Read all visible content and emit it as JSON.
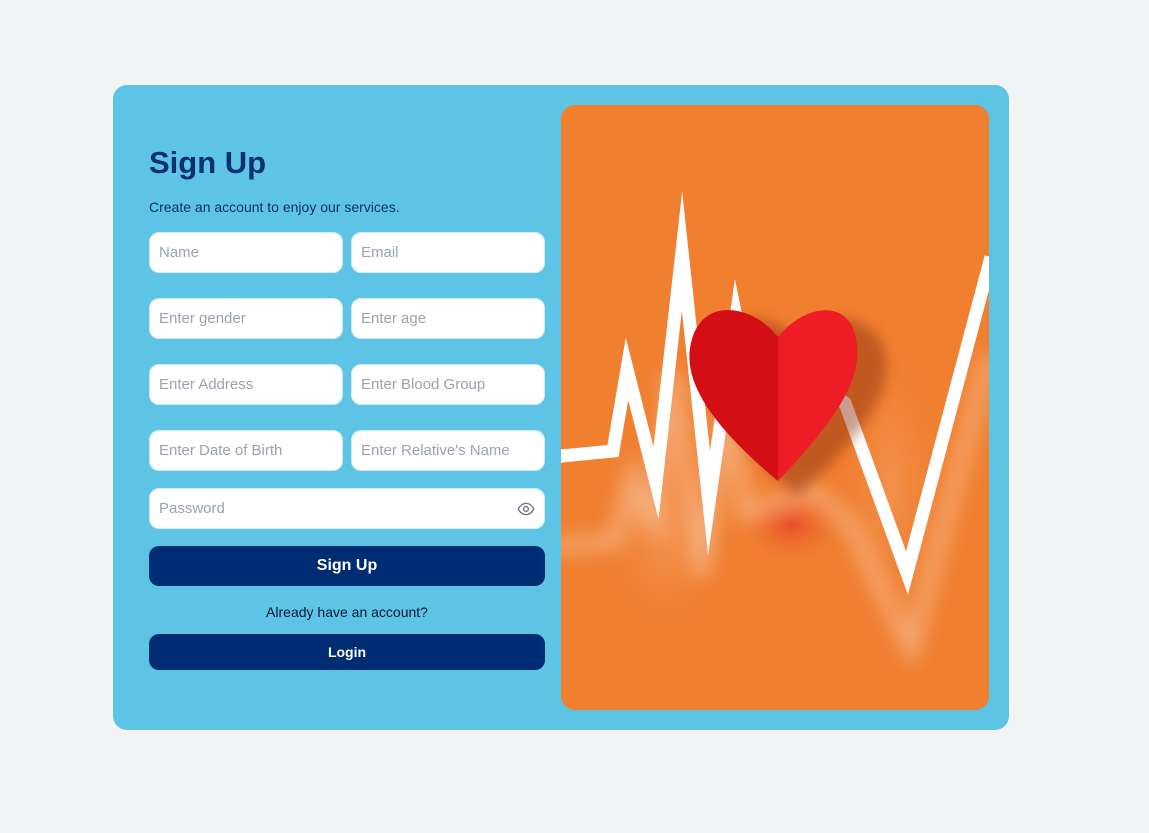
{
  "signup": {
    "title": "Sign Up",
    "subtitle": "Create an account to enjoy our services.",
    "fields": {
      "name": "Name",
      "email": "Email",
      "gender": "Enter gender",
      "age": "Enter age",
      "address": "Enter Address",
      "blood_group": "Enter Blood Group",
      "dob": "Enter Date of Birth",
      "relative_name": "Enter Relative's Name",
      "password": "Password"
    },
    "signup_button": "Sign Up",
    "already_text": "Already have an account?",
    "login_button": "Login"
  },
  "icons": {
    "password_toggle": "eye-icon"
  },
  "hero_image": {
    "subject": "heart-with-heartbeat-line"
  },
  "colors": {
    "page_background": "#f2f3f5",
    "card_background": "#5ec4e6",
    "primary": "#002c74",
    "title": "#0b2f73",
    "hero_background": "#f07f30",
    "heart_left": "#d30e15",
    "heart_right": "#ee1d25"
  }
}
